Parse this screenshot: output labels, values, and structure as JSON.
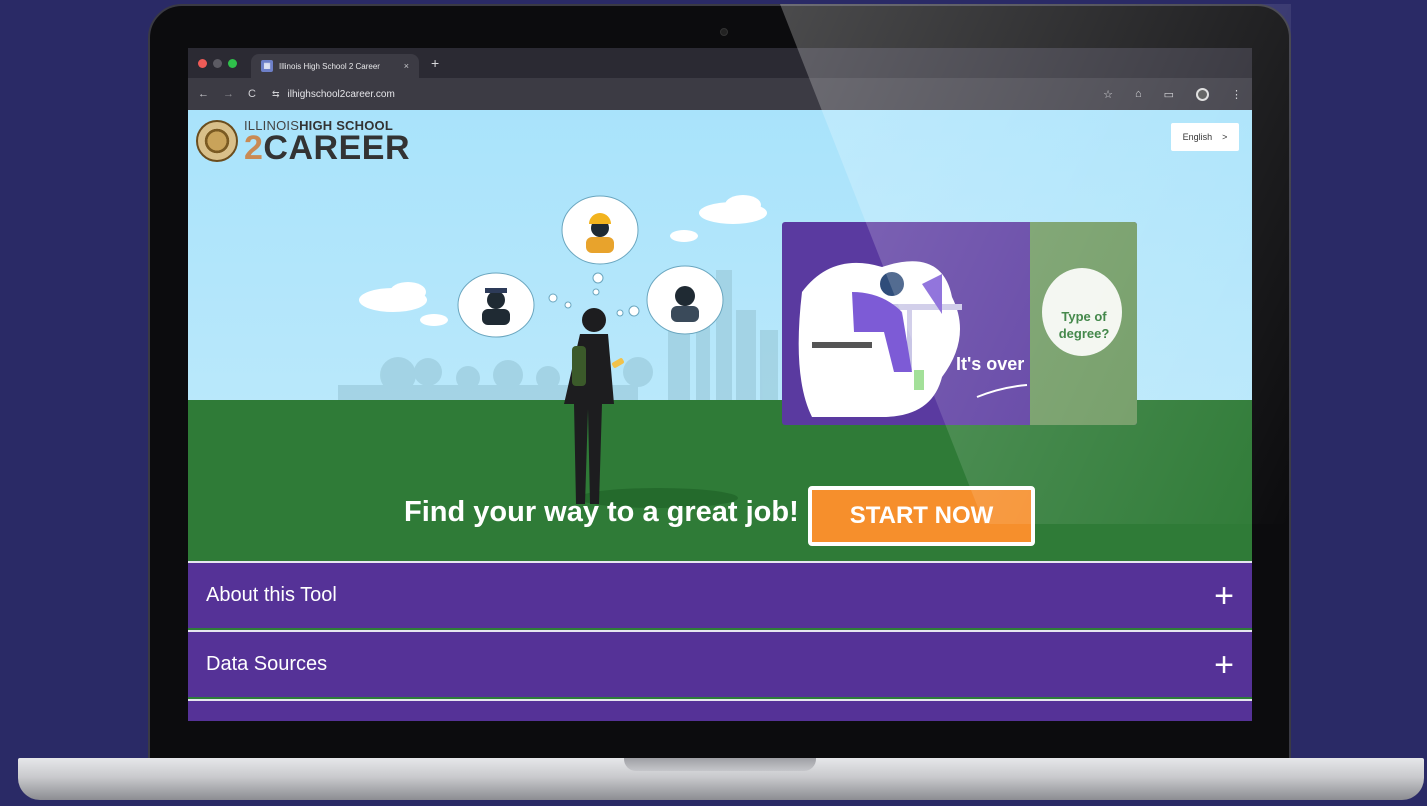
{
  "browser": {
    "tab_title": "Illinois High School 2 Career",
    "tab_close": "×",
    "new_tab": "+",
    "url": "ilhighschool2career.com",
    "nav": {
      "back": "←",
      "forward": "→",
      "reload": "C"
    },
    "toolbar_icons": [
      "star-icon",
      "extensions-icon",
      "sidepanel-icon",
      "profile-icon",
      "menu-icon"
    ]
  },
  "header": {
    "logo_line1_light": "ILLINOIS",
    "logo_line1_bold": "HIGH SCHOOL",
    "logo_two": "2",
    "logo_career": "CAREER",
    "language": "English",
    "language_chevron": ">"
  },
  "hero": {
    "video_caption": "It's over",
    "video_badge": "Type of degree?",
    "tagline": "Find your way to a great job!",
    "cta": "START NOW"
  },
  "accordion": [
    {
      "label": "About this Tool",
      "icon": "+"
    },
    {
      "label": "Data Sources",
      "icon": "+"
    }
  ],
  "colors": {
    "purple": "#553297",
    "orange": "#f68f2c",
    "grass": "#2f7b37",
    "sky": "#aee4fb"
  }
}
